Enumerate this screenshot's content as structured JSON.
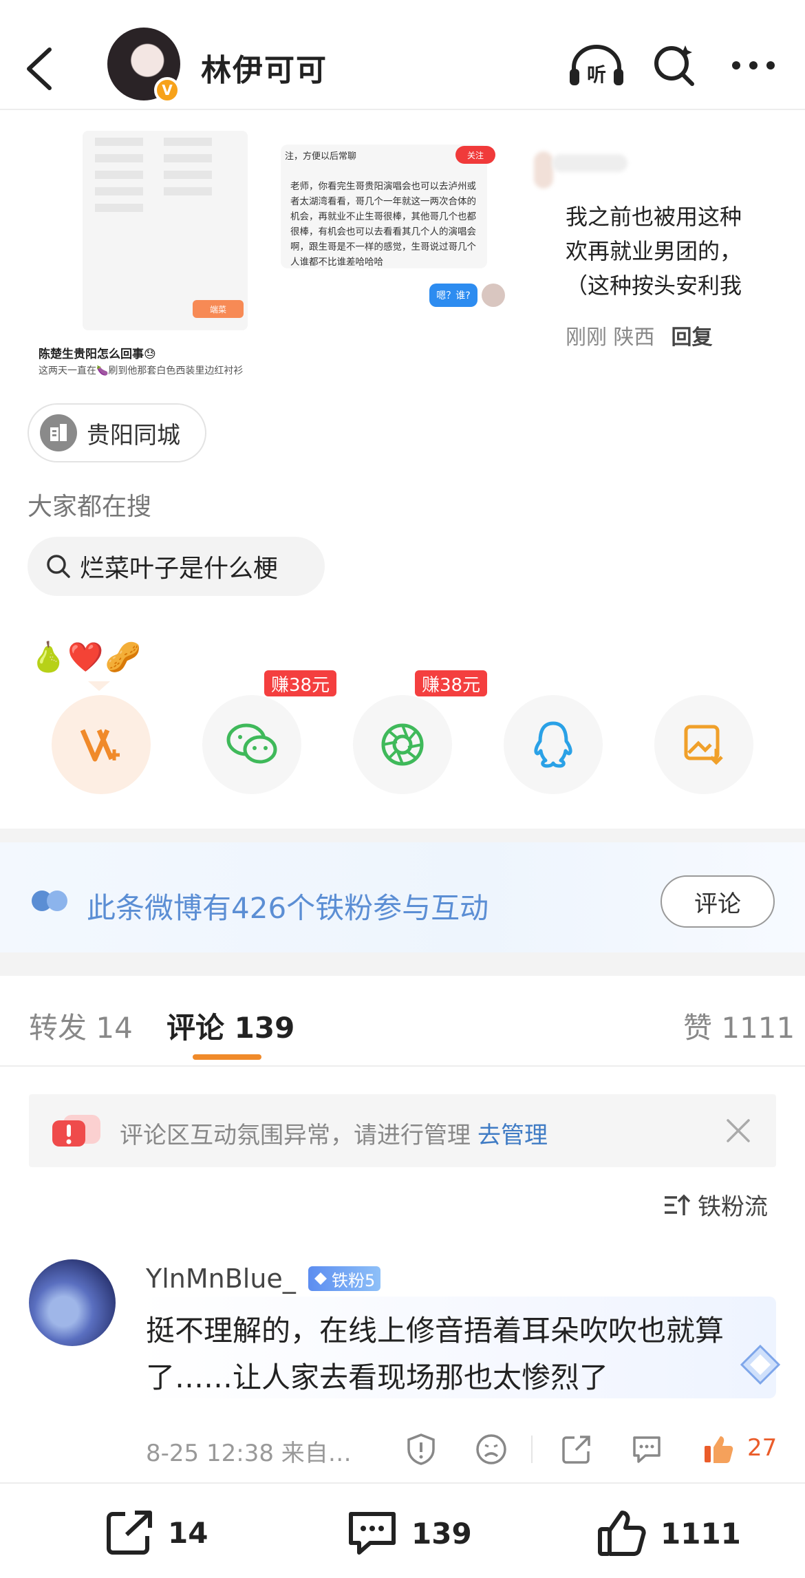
{
  "header": {
    "username": "林伊可可",
    "verified_badge": "V"
  },
  "thumbs": {
    "caption": "陈楚生贵阳怎么回事😓",
    "caption_sub": "这两天一直在🍆刷到他那套白色西装里边红衬衫",
    "chat_note": "注，方便以后常聊",
    "chat_follow": "关注",
    "chat_text": "老师，你看完生哥贵阳演唱会也可以去泸州或者太湖湾看看，哥几个一年就这一两次合体的机会，再就业不止生哥很棒，其他哥几个也都很棒，有机会也可以去看看其几个人的演唱会啊，跟生哥是不一样的感觉，生哥说过哥几个人谁都不比谁差哈哈哈",
    "chat_reply": "嗯？谁?",
    "phone_btn": "端菜",
    "comment_lines": [
      "我之前也被用这种",
      "欢再就业男团的，",
      "（这种按头安利我"
    ],
    "comment_time": "刚刚 陕西",
    "comment_reply": "回复"
  },
  "location_chip": "贵阳同城",
  "search": {
    "label": "大家都在搜",
    "query": "烂菜叶子是什么梗"
  },
  "emojis": "🍐❤️🥜",
  "share": {
    "earn1": "赚38元",
    "earn2": "赚38元"
  },
  "fans_banner": {
    "text": "此条微博有426个铁粉参与互动",
    "button": "评论"
  },
  "tabs": {
    "repost": "转发 14",
    "comment": "评论 139",
    "like": "赞 1111"
  },
  "notice": {
    "text": "评论区互动氛围异常，请进行管理",
    "link": "去管理"
  },
  "sort_label": "铁粉流",
  "comment": {
    "name": "YlnMnBlue_",
    "badge": "铁粉5",
    "text": "挺不理解的，在线上修音捂着耳朵吹吹也就算了……让人家去看现场那也太惨烈了",
    "meta": "8-25 12:38 来自…",
    "likes": "27"
  },
  "bottom_bar": {
    "reposts": "14",
    "comments": "139",
    "likes": "1111"
  },
  "colors": {
    "accent_orange": "#f08a2a",
    "link_blue": "#3f7bc4",
    "fans_blue": "#5b8ed4",
    "earn_red": "#f43f3f"
  }
}
